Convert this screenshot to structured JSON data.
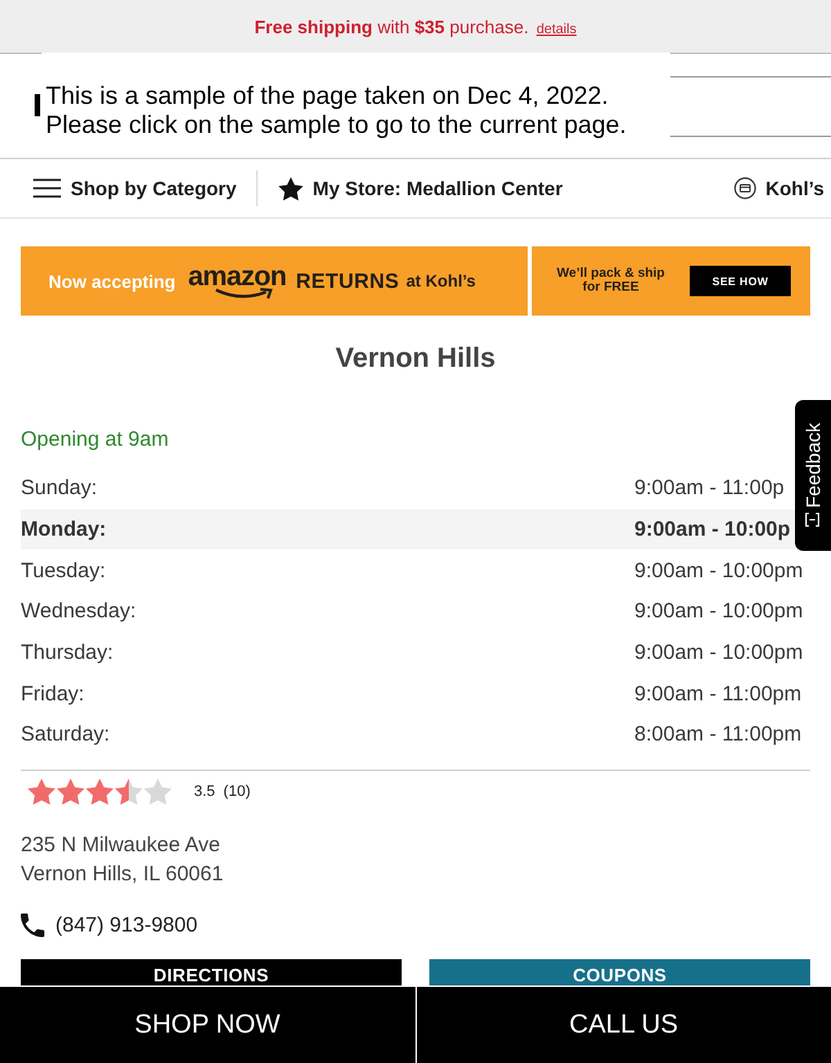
{
  "promo_bar": {
    "text": "**Free shipping** with **$35** purchase.",
    "link": "details"
  },
  "sample_notice": {
    "text": "This is a sample of the page taken on Dec 4, 2022.\nPlease click on the sample to go to the current page."
  },
  "nav": [
    {
      "kind": "menu",
      "label": "Shop by Category"
    },
    {
      "kind": "store",
      "label": "My Store: Medallion Center"
    },
    {
      "kind": "card",
      "label": "Kohl’s"
    }
  ],
  "banner": {
    "lead": "Now accepting",
    "logo": "amazon",
    "headline": "RETURNS",
    "suffix": "at Kohl’s",
    "note": "We’ll pack & ship\nfor FREE",
    "button": "SEE HOW"
  },
  "store": {
    "name": "Vernon Hills",
    "status": "Opening at 9am",
    "hours": [
      {
        "day": "Sunday:",
        "time": "9:00am - 11:00p",
        "today": false
      },
      {
        "day": "Monday:",
        "time": "9:00am - 10:00p",
        "today": true
      },
      {
        "day": "Tuesday:",
        "time": "9:00am - 10:00pm",
        "today": false
      },
      {
        "day": "Wednesday:",
        "time": "9:00am - 10:00pm",
        "today": false
      },
      {
        "day": "Thursday:",
        "time": "9:00am - 10:00pm",
        "today": false
      },
      {
        "day": "Friday:",
        "time": "9:00am - 11:00pm",
        "today": false
      },
      {
        "day": "Saturday:",
        "time": "8:00am - 11:00pm",
        "today": false
      }
    ],
    "rating": {
      "stars": 3.5,
      "score": "3.5",
      "count": "(10)"
    },
    "address": [
      "235 N Milwaukee Ave",
      "Vernon Hills, IL 60061"
    ],
    "phone": "(847) 913-9800",
    "actions": [
      {
        "kind": "primary",
        "label": "DIRECTIONS"
      },
      {
        "kind": "secondary",
        "label": "COUPONS"
      }
    ]
  },
  "bottom_bar": [
    {
      "label": "SHOP NOW"
    },
    {
      "label": "CALL US"
    }
  ],
  "feedback_tab": {
    "label": "Feedback"
  }
}
